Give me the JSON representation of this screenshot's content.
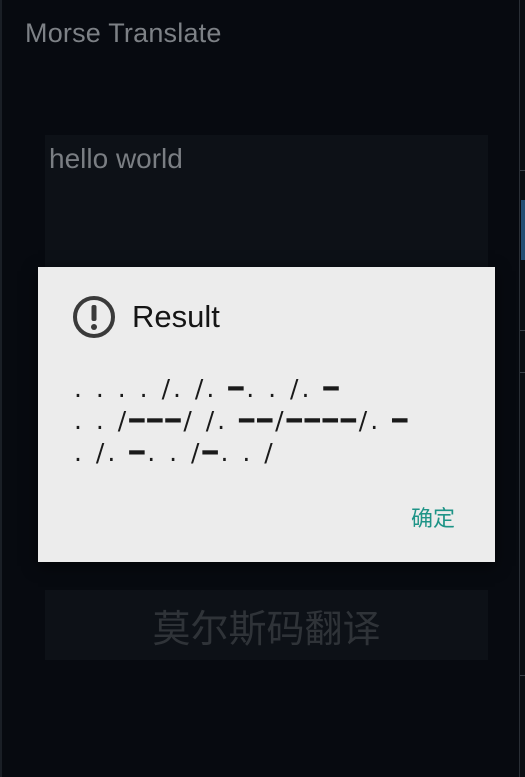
{
  "app": {
    "title": "Morse Translate"
  },
  "input": {
    "value": "hello world"
  },
  "translate_button": {
    "label": "莫尔斯码翻译"
  },
  "dialog": {
    "icon": "alert-circle-icon",
    "title": "Result",
    "message": ". . . . /. /. ━. . /. ━\n. . /━━━/ /. ━━/━━━━/. ━\n. /. ━. . /━. . /",
    "ok_label": "确定",
    "ok_color": "#1e9487"
  }
}
